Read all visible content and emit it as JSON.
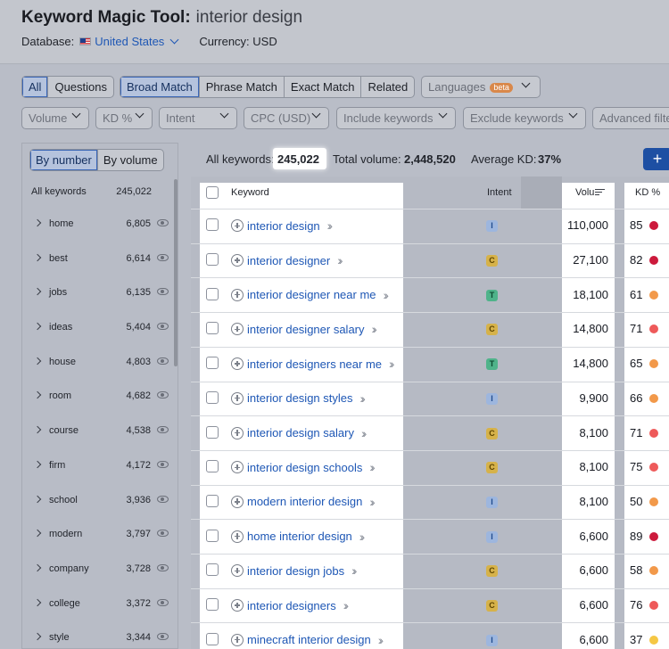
{
  "header": {
    "title": "Keyword Magic Tool:",
    "query": "interior design",
    "database_label": "Database:",
    "database_value": "United States",
    "currency": "Currency: USD"
  },
  "tabs": {
    "group1": [
      "All",
      "Questions"
    ],
    "group2": [
      "Broad Match",
      "Phrase Match",
      "Exact Match",
      "Related"
    ],
    "languages_label": "Languages",
    "beta": "beta"
  },
  "filters": [
    "Volume",
    "KD %",
    "Intent",
    "CPC (USD)",
    "Include keywords",
    "Exclude keywords",
    "Advanced filte"
  ],
  "sidebar": {
    "tabs": [
      "By number",
      "By volume"
    ],
    "all_label": "All keywords",
    "all_count": "245,022",
    "items": [
      {
        "label": "home",
        "count": "6,805"
      },
      {
        "label": "best",
        "count": "6,614"
      },
      {
        "label": "jobs",
        "count": "6,135"
      },
      {
        "label": "ideas",
        "count": "5,404"
      },
      {
        "label": "house",
        "count": "4,803"
      },
      {
        "label": "room",
        "count": "4,682"
      },
      {
        "label": "course",
        "count": "4,538"
      },
      {
        "label": "firm",
        "count": "4,172"
      },
      {
        "label": "school",
        "count": "3,936"
      },
      {
        "label": "modern",
        "count": "3,797"
      },
      {
        "label": "company",
        "count": "3,728"
      },
      {
        "label": "college",
        "count": "3,372"
      },
      {
        "label": "style",
        "count": "3,344"
      }
    ]
  },
  "summary": {
    "all_keywords_label": "All keywords:",
    "all_keywords_value": "245,022",
    "total_volume_label": "Total volume:",
    "total_volume_value": "2,448,520",
    "avg_kd_label": "Average KD:",
    "avg_kd_value": "37%",
    "add_button": "+"
  },
  "table": {
    "headers": {
      "keyword": "Keyword",
      "intent": "Intent",
      "volume": "Volu",
      "kd": "KD %"
    },
    "rows": [
      {
        "keyword": "interior design",
        "intent": "I",
        "volume": "110,000",
        "kd": "85",
        "kd_color": "#cc1a3c"
      },
      {
        "keyword": "interior designer",
        "intent": "C",
        "volume": "27,100",
        "kd": "82",
        "kd_color": "#cc1a3c"
      },
      {
        "keyword": "interior designer near me",
        "intent": "T",
        "volume": "18,100",
        "kd": "61",
        "kd_color": "#f2994a"
      },
      {
        "keyword": "interior designer salary",
        "intent": "C",
        "volume": "14,800",
        "kd": "71",
        "kd_color": "#ee5a5a"
      },
      {
        "keyword": "interior designers near me",
        "intent": "T",
        "volume": "14,800",
        "kd": "65",
        "kd_color": "#f2994a"
      },
      {
        "keyword": "interior design styles",
        "intent": "I",
        "volume": "9,900",
        "kd": "66",
        "kd_color": "#f2994a"
      },
      {
        "keyword": "interior design salary",
        "intent": "C",
        "volume": "8,100",
        "kd": "71",
        "kd_color": "#ee5a5a"
      },
      {
        "keyword": "interior design schools",
        "intent": "C",
        "volume": "8,100",
        "kd": "75",
        "kd_color": "#ee5a5a"
      },
      {
        "keyword": "modern interior design",
        "intent": "I",
        "volume": "8,100",
        "kd": "50",
        "kd_color": "#f2994a"
      },
      {
        "keyword": "home interior design",
        "intent": "I",
        "volume": "6,600",
        "kd": "89",
        "kd_color": "#cc1a3c"
      },
      {
        "keyword": "interior design jobs",
        "intent": "C",
        "volume": "6,600",
        "kd": "58",
        "kd_color": "#f2994a"
      },
      {
        "keyword": "interior designers",
        "intent": "C",
        "volume": "6,600",
        "kd": "76",
        "kd_color": "#ee5a5a"
      },
      {
        "keyword": "minecraft interior design",
        "intent": "I",
        "volume": "6,600",
        "kd": "37",
        "kd_color": "#f5c744"
      }
    ],
    "intent_colors": {
      "I": {
        "bg": "#9db6de",
        "fg": "#1e4a8c"
      },
      "C": {
        "bg": "#d6b24a",
        "fg": "#5e4500"
      },
      "T": {
        "bg": "#4fb38a",
        "fg": "#0e4a30"
      }
    }
  }
}
